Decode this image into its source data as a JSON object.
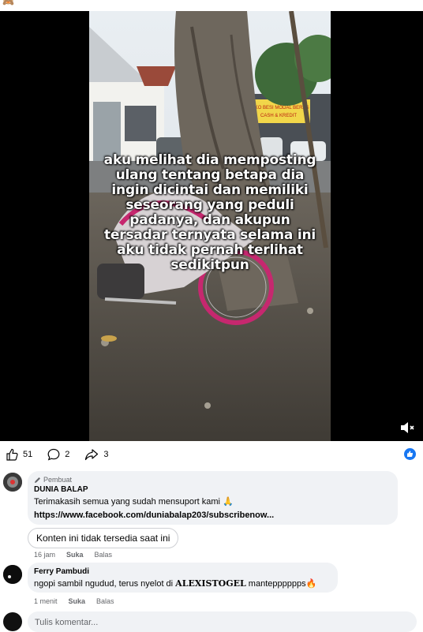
{
  "video": {
    "caption": "aku melihat dia memposting ulang tentang betapa dia ingin dicintai dan memiliki seseorang yang peduli padanya, dan akupun tersadar ternyata selama ini aku tidak pernah terlihat sedikitpun",
    "volume_icon": "volume-muted-icon",
    "billboard_text_1": "TOKO BESI MODAL BERAS",
    "billboard_text_2": "CASH & KREDIT"
  },
  "actions": {
    "likes": "51",
    "comments": "2",
    "shares": "3"
  },
  "comments": [
    {
      "badge": "Pembuat",
      "author": "DUNIA BALAP",
      "text": "Terimakasih semua yang sudah mensuport kami 🙏",
      "link": "https://www.facebook.com/duniabalap203/subscribenow...",
      "time": "16 jam",
      "like_label": "Suka",
      "reply_label": "Balas"
    },
    {
      "author": "Ferry Pambudi",
      "text_before": "ngopi sambil ngudud, terus nyelot di ",
      "text_bold": "ALEXISTOGEL",
      "text_after": " mantepppppps🔥",
      "time": "1 menit",
      "like_label": "Suka",
      "reply_label": "Balas"
    }
  ],
  "unavailable_text": "Konten ini tidak tersedia saat ini",
  "compose": {
    "placeholder": "Tulis komentar..."
  },
  "colors": {
    "accent": "#1877f2",
    "bubble": "#f0f2f5",
    "muted": "#65676b"
  }
}
